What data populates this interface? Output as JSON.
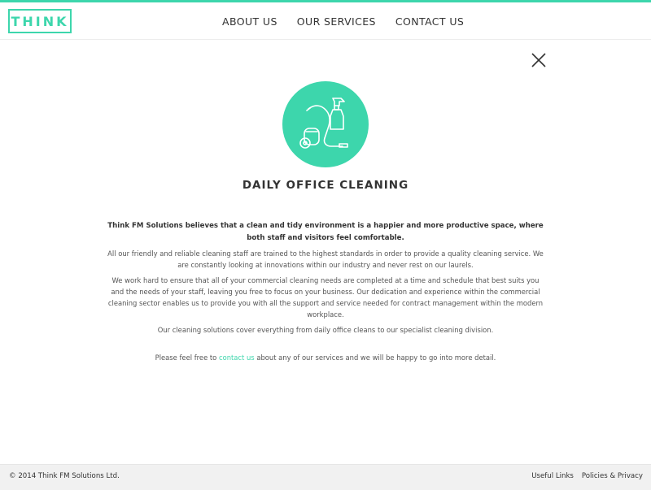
{
  "header": {
    "logo_text": "THINK",
    "nav": [
      {
        "label": "ABOUT US"
      },
      {
        "label": "OUR SERVICES"
      },
      {
        "label": "CONTACT US"
      }
    ]
  },
  "colors": {
    "accent": "#3dd6ac",
    "text": "#4a4a4a",
    "footer_bg": "#f1f1f1"
  },
  "modal": {
    "icon": "vacuum-spray-icon",
    "title": "DAILY OFFICE CLEANING",
    "lead": "Think FM Solutions believes that a clean and tidy environment is a happier and more productive space, where both staff and visitors feel comfortable.",
    "paragraphs": [
      "All our friendly and reliable cleaning staff are trained to the highest standards in order to provide a quality cleaning service. We are constantly looking at innovations within our industry and never rest on our laurels.",
      "We work hard to ensure that all of your commercial cleaning needs are completed at a time and schedule that best suits you and the needs of your staff, leaving you free to focus on your business. Our dedication and experience within the commercial cleaning sector enables us to provide you with all the support and service needed for contract management within the modern workplace.",
      "Our cleaning solutions cover everything from daily office cleans to our specialist cleaning division."
    ],
    "cta": {
      "before": "Please feel free to ",
      "link": "contact us",
      "after": " about any of our services and we will be happy to go into more detail."
    }
  },
  "footer": {
    "copyright": "© 2014 Think FM Solutions Ltd.",
    "links": [
      {
        "label": "Useful Links"
      },
      {
        "label": "Policies & Privacy"
      }
    ]
  }
}
